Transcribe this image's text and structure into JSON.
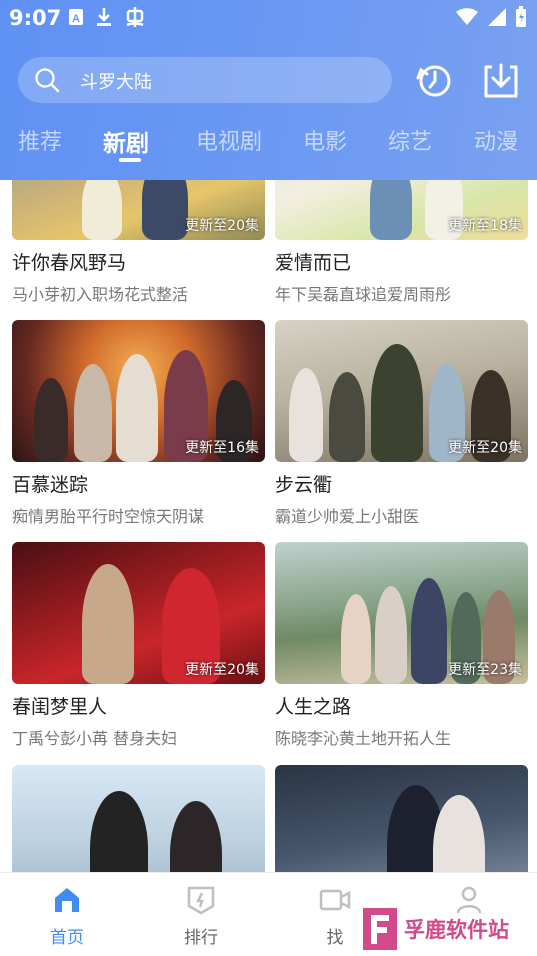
{
  "status_bar": {
    "time": "9:07"
  },
  "search": {
    "query": "斗罗大陆"
  },
  "tabs": [
    {
      "label": "推荐"
    },
    {
      "label": "新剧"
    },
    {
      "label": "电视剧"
    },
    {
      "label": "电影"
    },
    {
      "label": "综艺"
    },
    {
      "label": "动漫"
    }
  ],
  "active_tab": "新剧",
  "cards": [
    {
      "title": "许你春风野马",
      "subtitle": "马小芽初入职场花式整活",
      "badge": "更新至20集"
    },
    {
      "title": "爱情而已",
      "subtitle": "年下吴磊直球追爱周雨彤",
      "badge": "更新至18集"
    },
    {
      "title": "百慕迷踪",
      "subtitle": "痴情男胎平行时空惊天阴谋",
      "badge": "更新至16集"
    },
    {
      "title": "步云衢",
      "subtitle": "霸道少帅爱上小甜医",
      "badge": "更新至20集"
    },
    {
      "title": "春闺梦里人",
      "subtitle": "丁禹兮彭小苒 替身夫妇",
      "badge": "更新至20集"
    },
    {
      "title": "人生之路",
      "subtitle": "陈晓李沁黄土地开拓人生",
      "badge": "更新至23集"
    },
    {
      "title": "",
      "subtitle": "",
      "badge": ""
    },
    {
      "title": "",
      "subtitle": "",
      "badge": ""
    }
  ],
  "bottom_nav": [
    {
      "label": "首页",
      "icon": "home-icon"
    },
    {
      "label": "排行",
      "icon": "ranking-icon"
    },
    {
      "label": "找",
      "icon": "video-icon"
    },
    {
      "label": "",
      "icon": "profile-icon"
    }
  ],
  "watermark": {
    "text": "孚鹿软件站"
  },
  "colors": {
    "header": "#6a98f3",
    "accent": "#3f8cf3"
  }
}
